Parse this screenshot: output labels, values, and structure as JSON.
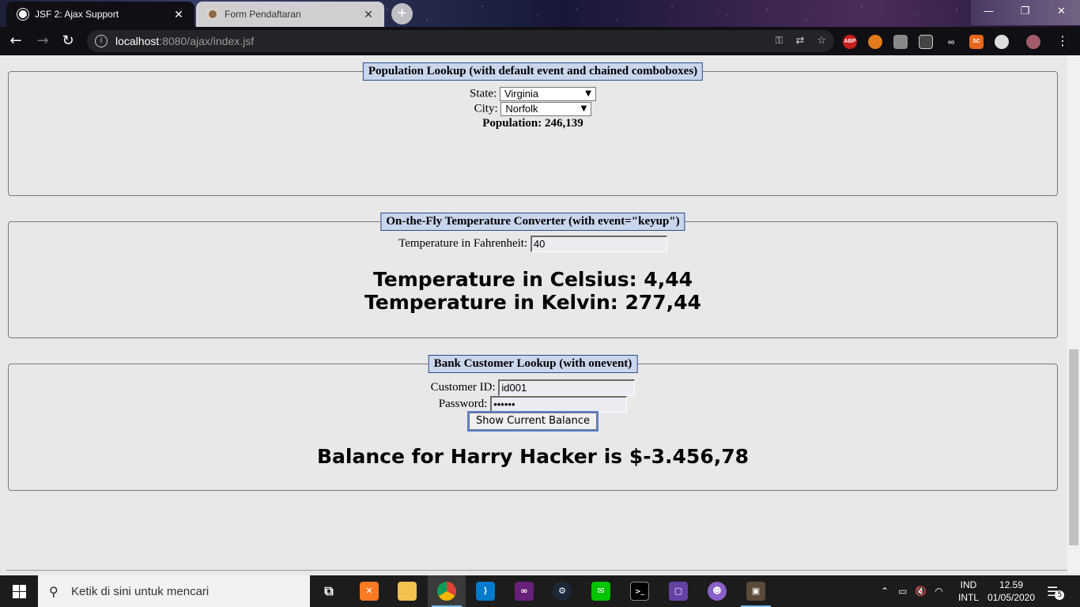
{
  "browser": {
    "tabs": [
      {
        "title": "JSF 2: Ajax Support",
        "active": true
      },
      {
        "title": "Form Pendaftaran",
        "active": false
      }
    ],
    "url_host": "localhost",
    "url_rest": ":8080/ajax/index.jsf",
    "extensions": [
      "ABP",
      "SC"
    ]
  },
  "population": {
    "legend": "Population Lookup (with default event and chained comboboxes)",
    "state_label": "State:",
    "state_value": "Virginia",
    "city_label": "City:",
    "city_value": "Norfolk",
    "result": "Population: 246,139"
  },
  "temperature": {
    "legend": "On-the-Fly Temperature Converter (with event=\"keyup\")",
    "input_label": "Temperature in Fahrenheit:",
    "input_value": "40",
    "celsius": "Temperature in Celsius: 4,44",
    "kelvin": "Temperature in Kelvin: 277,44"
  },
  "bank": {
    "legend": "Bank Customer Lookup (with onevent)",
    "id_label": "Customer ID:",
    "id_value": "id001",
    "password_label": "Password:",
    "password_value": "••••••",
    "button_label": "Show Current Balance",
    "result": "Balance for Harry Hacker is $-3.456,78"
  },
  "taskbar": {
    "search_placeholder": "Ketik di sini untuk mencari",
    "language_top": "IND",
    "language_bottom": "INTL",
    "time": "12.59",
    "date": "01/05/2020",
    "notification_count": "5"
  }
}
